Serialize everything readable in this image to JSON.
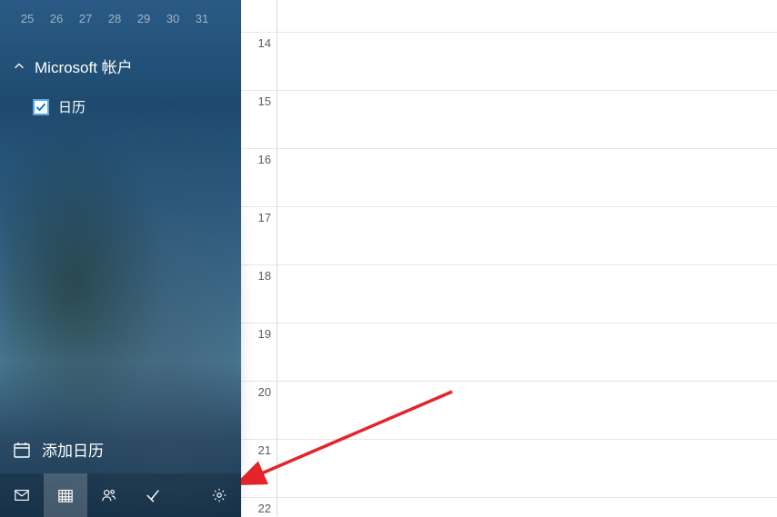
{
  "miniCalendar": {
    "trailingDays": [
      "25",
      "26",
      "27",
      "28",
      "29",
      "30",
      "31"
    ]
  },
  "account": {
    "title": "Microsoft 帐户",
    "calendars": [
      {
        "label": "日历",
        "checked": true
      }
    ]
  },
  "addCalendar": {
    "label": "添加日历"
  },
  "hours": [
    "14",
    "15",
    "16",
    "17",
    "18",
    "19",
    "20",
    "21",
    "22"
  ]
}
